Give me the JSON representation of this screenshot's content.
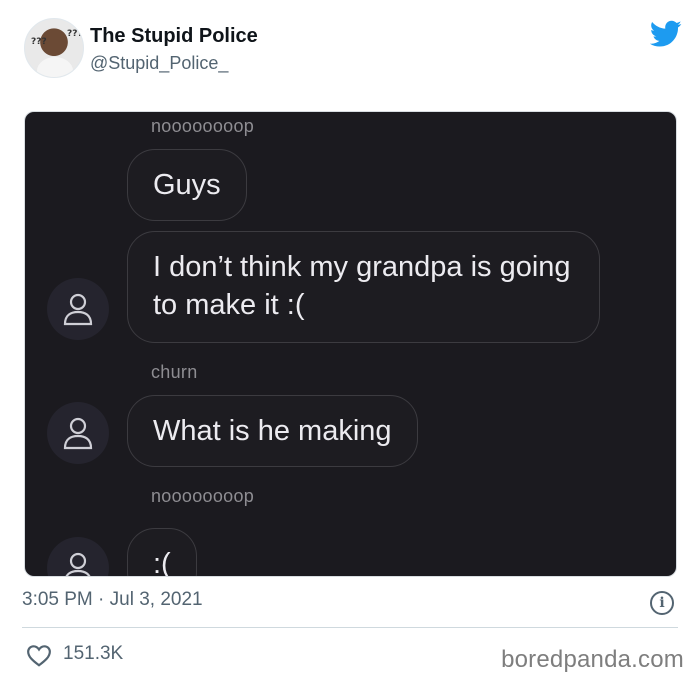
{
  "tweet": {
    "display_name": "The Stupid Police",
    "handle": "@Stupid_Police_",
    "timestamp": "3:05 PM · Jul 3, 2021",
    "likes": "151.3K"
  },
  "icons": {
    "avatar_glyph_left": "???",
    "avatar_glyph_right": "???",
    "platform": "twitter-bird-icon",
    "info": "info-icon",
    "like": "heart-icon"
  },
  "chat": {
    "messages": [
      {
        "sender": "noooooooop",
        "text": "Guys"
      },
      {
        "sender": "",
        "text": "I don’t think my grandpa is going to make it :("
      },
      {
        "sender": "churn",
        "text": "What is he making"
      },
      {
        "sender": "noooooooop",
        "text": ":("
      }
    ]
  },
  "watermark": "boredpanda.com",
  "colors": {
    "twitter_blue": "#1d9bf0",
    "chat_background": "#1b1a1f",
    "meta_gray": "#536471"
  }
}
